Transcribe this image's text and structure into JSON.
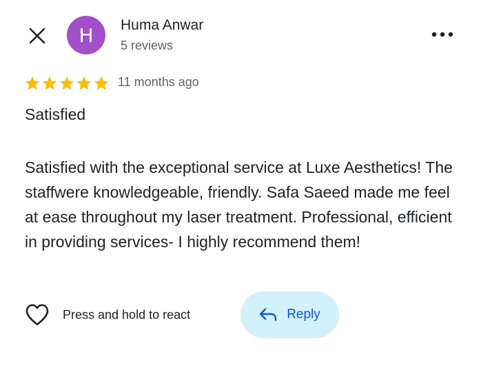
{
  "review": {
    "author": {
      "name": "Huma Anwar",
      "meta": "5 reviews",
      "avatar_letter": "H"
    },
    "rating": 5,
    "rating_max": 5,
    "time": "11 months ago",
    "title": "Satisfied",
    "body": "Satisfied with the exceptional service at Luxe Aesthetics! The staffwere knowledgeable, friendly. Safa Saeed made me feel at ease throughout my laser treatment. Professional, efficient in providing services- I highly recommend them!"
  },
  "actions": {
    "react_label": "Press and hold to react",
    "reply_label": "Reply"
  },
  "icons": {
    "close": "close-icon",
    "more": "more-vert-icon",
    "star": "star-icon",
    "react": "heart-outline-icon",
    "reply": "reply-arrow-icon"
  },
  "colors": {
    "avatar_bg": "#a34fc8",
    "star": "#fbbc04",
    "reply_bg": "#d3f1fb",
    "reply_text": "#0b57d0",
    "text_primary": "#202124",
    "text_secondary": "#5f6368"
  }
}
